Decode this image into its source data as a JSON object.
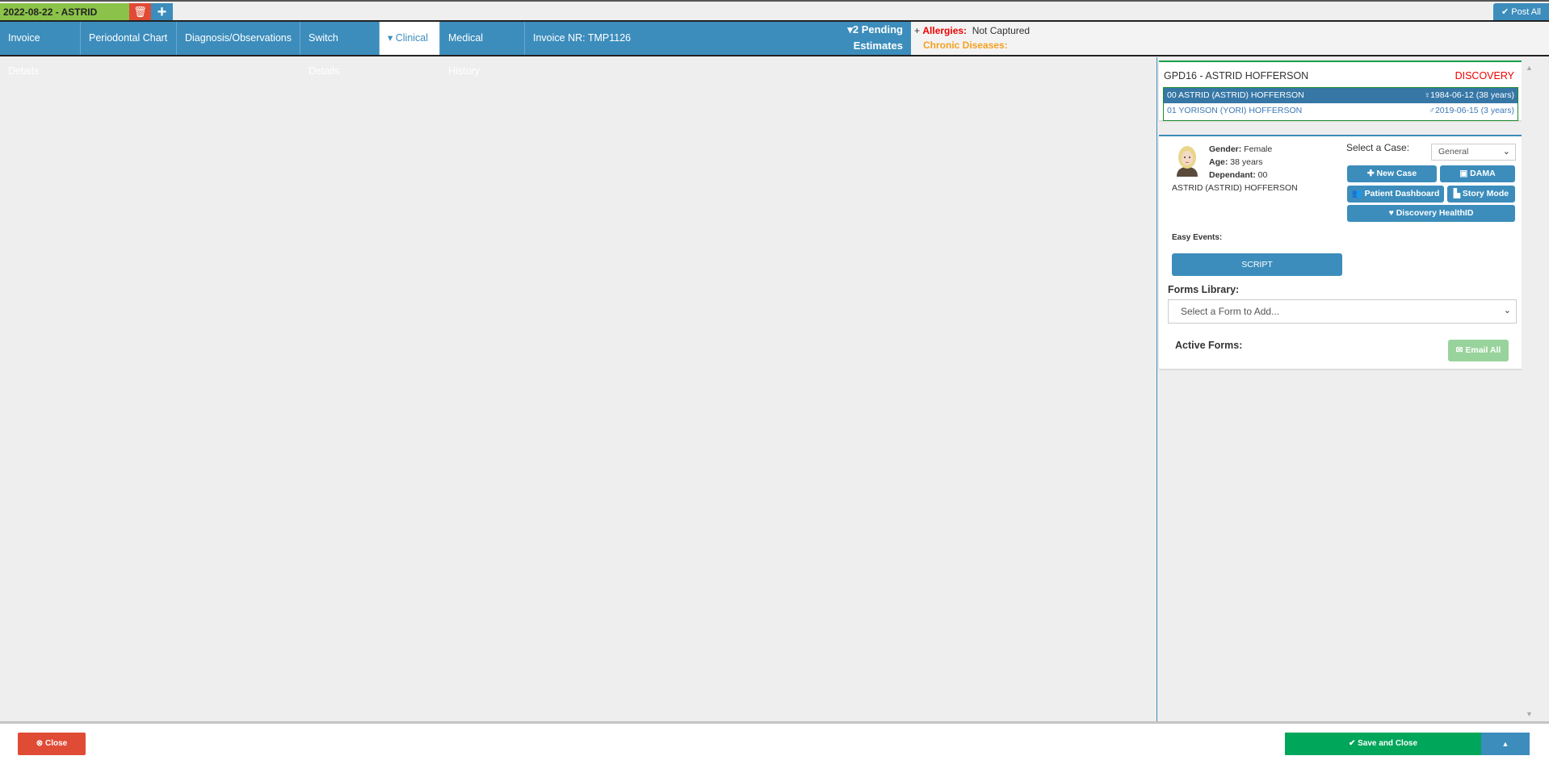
{
  "top": {
    "tab_label": "2022-08-22 - ASTRID",
    "post_all": "Post All"
  },
  "nav": {
    "tabs": [
      "Invoice Details",
      "Periodontal Chart",
      "Diagnosis/Observations",
      "Switch Details",
      "Clinical",
      "Medical History",
      "Invoice NR: TMP1126"
    ],
    "pending_line1": "2 Pending",
    "pending_line2": "Estimates"
  },
  "alerts": {
    "plus": "+",
    "allergies_label": "Allergies:",
    "allergies_value": "Not Captured",
    "chronic_label": "Chronic Diseases:"
  },
  "family": {
    "title": "GPD16 - ASTRID HOFFERSON",
    "scheme": "DISCOVERY",
    "members": [
      {
        "name": "00 ASTRID (ASTRID) HOFFERSON",
        "dob": "1984-06-12 (38 years)",
        "gender_icon": "♀"
      },
      {
        "name": "01 YORISON (YORI) HOFFERSON",
        "dob": "2019-06-15 (3 years)",
        "gender_icon": "♂"
      }
    ]
  },
  "patient": {
    "gender_label": "Gender:",
    "gender": "Female",
    "age_label": "Age:",
    "age": "38 years",
    "dependant_label": "Dependant:",
    "dependant": "00",
    "full_name": "ASTRID (ASTRID) HOFFERSON",
    "select_case_label": "Select a Case:",
    "case_value": "General",
    "new_case": "New Case",
    "dama": "DAMA",
    "patient_dashboard": "Patient Dashboard",
    "story_mode": "Story Mode",
    "discovery_healthid": "Discovery HealthID",
    "easy_events_label": "Easy Events:",
    "script": "SCRIPT",
    "forms_library_label": "Forms Library:",
    "forms_placeholder": "Select a Form to Add...",
    "active_forms_label": "Active Forms:",
    "email_all": "Email All"
  },
  "footer": {
    "close": "Close",
    "save_close": "Save and Close"
  }
}
